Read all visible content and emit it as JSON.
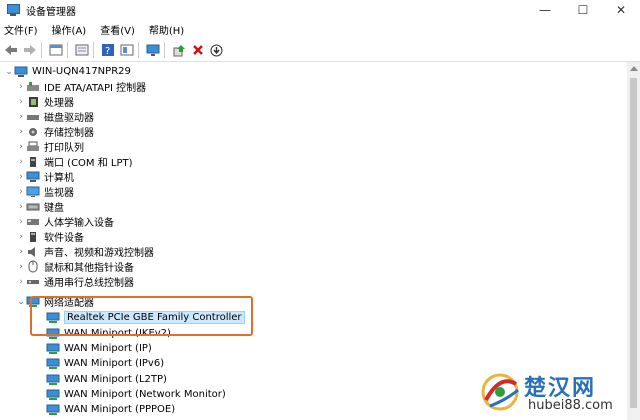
{
  "window": {
    "title": "设备管理器",
    "minimize": "—",
    "maximize": "☐",
    "close": "✕"
  },
  "menu": [
    "文件(F)",
    "操作(A)",
    "查看(V)",
    "帮助(H)"
  ],
  "toolbar": {
    "icons": [
      "back-arrow-icon",
      "forward-arrow-icon",
      "properties-icon",
      "show-hidden-icon",
      "help-icon",
      "device-view-icon",
      "monitor-scan-icon",
      "update-driver-icon",
      "uninstall-icon",
      "download-icon"
    ]
  },
  "tree": {
    "root": "WIN-UQN417NPR29",
    "categories": [
      "IDE ATA/ATAPI 控制器",
      "处理器",
      "磁盘驱动器",
      "存储控制器",
      "打印队列",
      "端口 (COM 和 LPT)",
      "计算机",
      "监视器",
      "键盘",
      "人体学输入设备",
      "软件设备",
      "声音、视频和游戏控制器",
      "鼠标和其他指针设备",
      "通用串行总线控制器"
    ],
    "expanded_category": "网络适配器",
    "network_children": [
      "Realtek PCIe GBE Family Controller",
      "WAN Miniport (IKEv2)",
      "WAN Miniport (IP)",
      "WAN Miniport (IPv6)",
      "WAN Miniport (L2TP)",
      "WAN Miniport (Network Monitor)",
      "WAN Miniport (PPPOE)"
    ]
  },
  "watermark": {
    "cn": "楚汉网",
    "url": "hubei88.com"
  },
  "colors": {
    "highlight_border": "#e06f2c",
    "selection": "#cce8ff",
    "icon_blue": "#3b8fd6"
  }
}
